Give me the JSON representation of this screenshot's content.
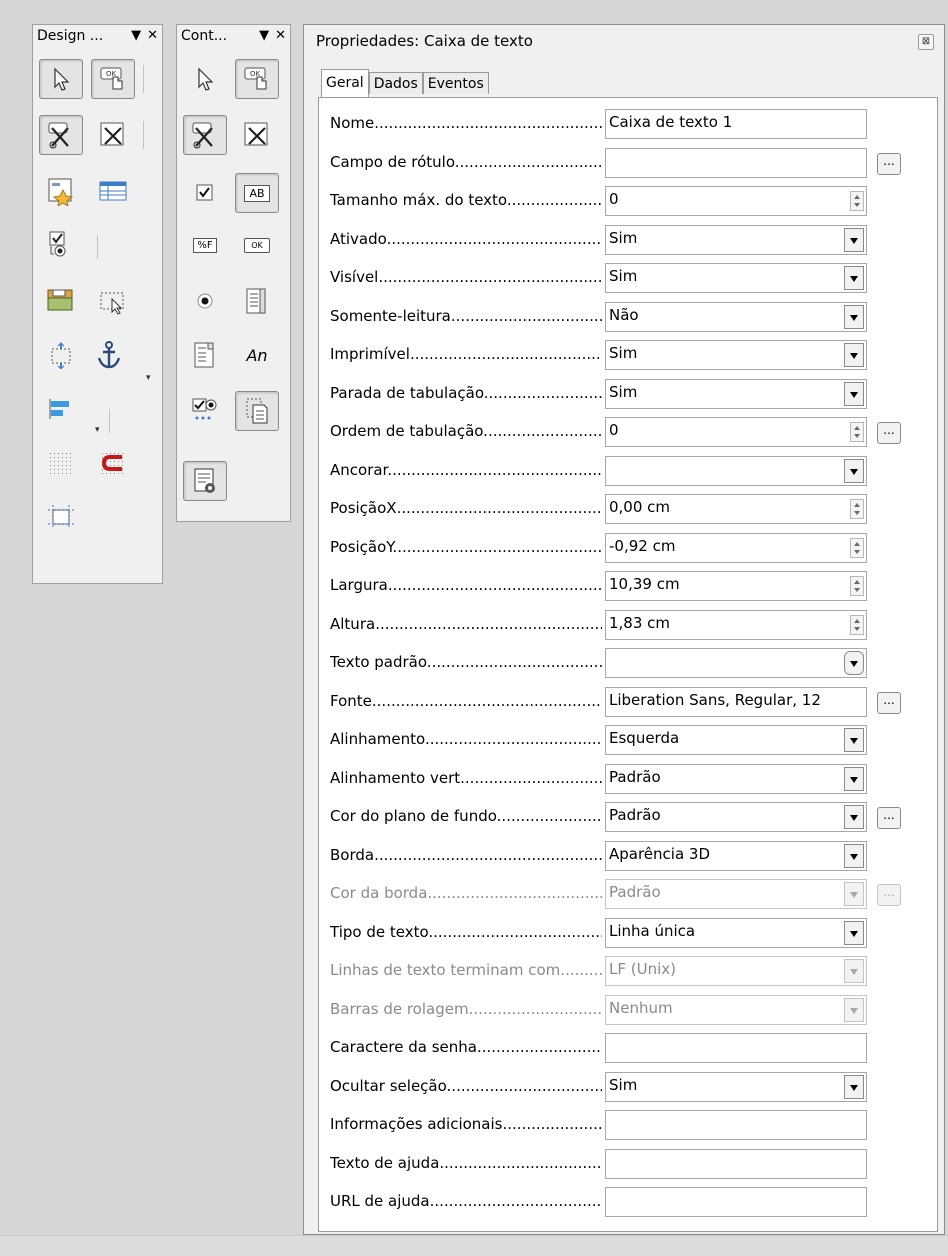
{
  "design_toolbar": {
    "title": "Design ...",
    "menu_glyph": "▼",
    "close_glyph": "✕",
    "buttons": [
      "select-icon",
      "form-design-icon",
      "design-mode-icon",
      "control-properties-icon",
      "form-properties-icon",
      "form-navigator-icon",
      "activation-order-icon",
      "add-field-icon",
      "open-design-mode-icon",
      "position-size-icon",
      "anchor-icon",
      "align-icon",
      "display-grid-icon",
      "snap-to-grid-icon",
      "helplines-icon"
    ]
  },
  "controls_toolbar": {
    "title": "Cont...",
    "menu_glyph": "▼",
    "close_glyph": "✕",
    "buttons": [
      "select-icon",
      "form-design-icon",
      "design-mode-icon",
      "control-properties-icon",
      "checkbox-icon",
      "text-box-icon",
      "formatted-field-icon",
      "push-button-icon",
      "option-button-icon",
      "list-box-icon",
      "combo-box-icon",
      "label-field-icon",
      "more-controls-icon",
      "form-design-tool-icon",
      "wizards-icon"
    ],
    "formatted_glyph": "%F",
    "ok_glyph": "OK",
    "label_glyph": "An",
    "textbox_glyph": "AB"
  },
  "dialog": {
    "title": "Propriedades: Caixa de texto",
    "close_glyph": "⊠",
    "tabs": [
      "Geral",
      "Dados",
      "Eventos"
    ],
    "active_tab": "Geral",
    "dots_label": "...",
    "rows": [
      {
        "label": "Nome",
        "value": "Caixa de texto 1"
      },
      {
        "label": "Campo de rótulo",
        "value": ""
      },
      {
        "label": "Tamanho máx. do texto",
        "value": "0"
      },
      {
        "label": "Ativado",
        "value": "Sim"
      },
      {
        "label": "Visível",
        "value": "Sim"
      },
      {
        "label": "Somente-leitura",
        "value": "Não"
      },
      {
        "label": "Imprimível",
        "value": "Sim"
      },
      {
        "label": "Parada de tabulação",
        "value": "Sim"
      },
      {
        "label": "Ordem de tabulação",
        "value": "0"
      },
      {
        "label": "Ancorar",
        "value": ""
      },
      {
        "label": "PosiçãoX",
        "value": "0,00 cm"
      },
      {
        "label": "PosiçãoY",
        "value": "-0,92 cm"
      },
      {
        "label": "Largura",
        "value": "10,39 cm"
      },
      {
        "label": "Altura",
        "value": "1,83 cm"
      },
      {
        "label": "Texto padrão",
        "value": ""
      },
      {
        "label": "Fonte",
        "value": "Liberation Sans, Regular, 12"
      },
      {
        "label": "Alinhamento",
        "value": "Esquerda"
      },
      {
        "label": "Alinhamento vert",
        "value": "Padrão"
      },
      {
        "label": "Cor do plano de fundo",
        "value": "Padrão"
      },
      {
        "label": "Borda",
        "value": "Aparência 3D"
      },
      {
        "label": "Cor da borda",
        "value": "Padrão"
      },
      {
        "label": "Tipo de texto",
        "value": "Linha única"
      },
      {
        "label": "Linhas de texto terminam com",
        "value": "LF (Unix)"
      },
      {
        "label": "Barras de rolagem",
        "value": "Nenhum"
      },
      {
        "label": "Caractere da senha",
        "value": ""
      },
      {
        "label": "Ocultar seleção",
        "value": "Sim"
      },
      {
        "label": "Informações adicionais",
        "value": ""
      },
      {
        "label": "Texto de ajuda",
        "value": ""
      },
      {
        "label": "URL de ajuda",
        "value": ""
      }
    ]
  }
}
